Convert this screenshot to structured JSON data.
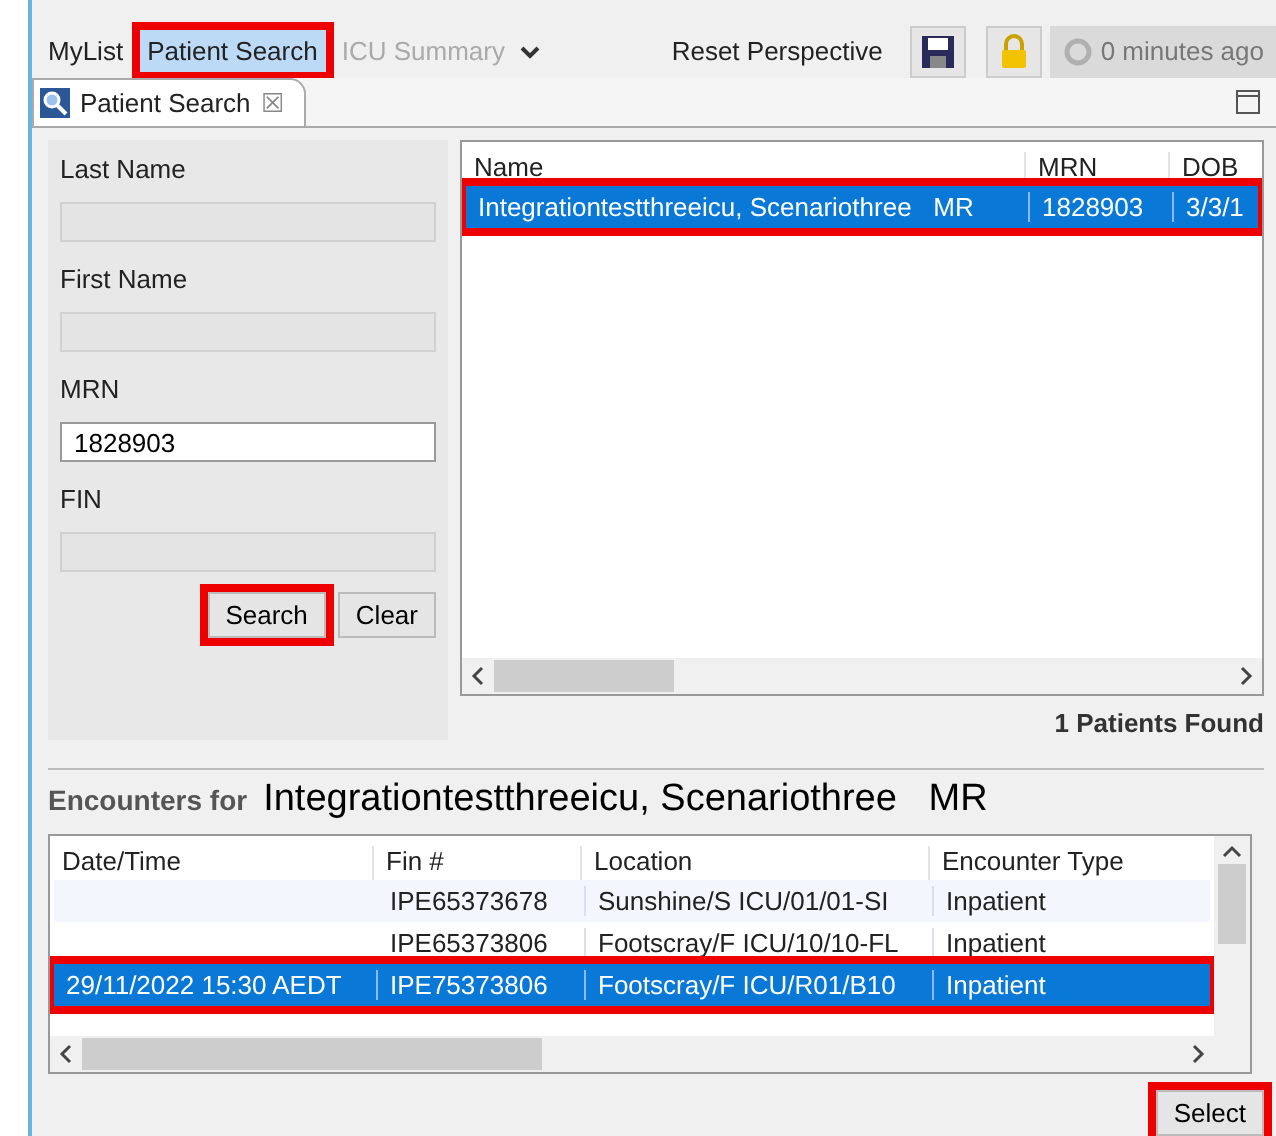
{
  "toolbar": {
    "items": [
      {
        "label": "MyList",
        "selected": false,
        "disabled": false,
        "highlighted": false
      },
      {
        "label": "Patient Search",
        "selected": true,
        "disabled": false,
        "highlighted": true
      },
      {
        "label": "ICU Summary",
        "selected": false,
        "disabled": true,
        "highlighted": false
      }
    ],
    "reset_label": "Reset Perspective",
    "refresh_label": "0 minutes ago"
  },
  "view_tab": {
    "title": "Patient Search",
    "close": "☒"
  },
  "search_form": {
    "fields": [
      {
        "label": "Last Name"
      },
      {
        "label": "First Name"
      },
      {
        "label": "MRN",
        "value": "1828903"
      },
      {
        "label": "FIN"
      }
    ],
    "buttons": [
      {
        "label": "Search",
        "highlighted": true
      },
      {
        "label": "Clear",
        "highlighted": false
      }
    ]
  },
  "patients": {
    "columns": [
      "Name",
      "MRN",
      "DOB"
    ],
    "rows": [
      {
        "cells": [
          "Integrationtestthreeicu, Scenariothree   MR",
          "1828903",
          "3/3/1"
        ],
        "selected": true,
        "highlighted": true
      }
    ],
    "count": "1 Patients Found"
  },
  "encounters": {
    "label": "Encounters for",
    "patient": "Integrationtestthreeicu, Scenariothree   MR",
    "columns": [
      "Date/Time",
      "Fin #",
      "Location",
      "Encounter Type"
    ],
    "rows": [
      {
        "cells": [
          null,
          "IPE65373678",
          "Sunshine/S ICU/01/01-SI",
          "Inpatient"
        ],
        "selected": false,
        "highlighted": false
      },
      {
        "cells": [
          null,
          "IPE65373806",
          "Footscray/F ICU/10/10-FL",
          "Inpatient"
        ],
        "selected": false,
        "highlighted": false
      },
      {
        "cells": [
          "29/11/2022 15:30 AEDT",
          "IPE75373806",
          "Footscray/F ICU/R01/B10",
          "Inpatient"
        ],
        "selected": true,
        "highlighted": true
      }
    ],
    "select_button": {
      "label": "Select",
      "highlighted": true
    }
  }
}
